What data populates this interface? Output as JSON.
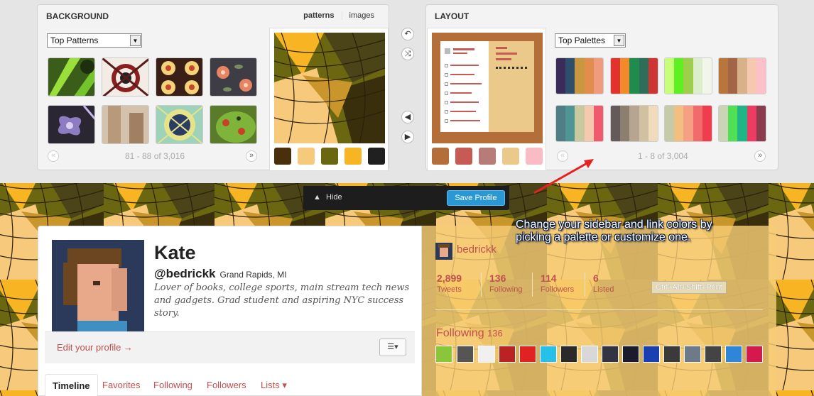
{
  "background_panel": {
    "title": "BACKGROUND",
    "tabs": [
      "patterns",
      "images"
    ],
    "active_tab": "patterns",
    "select_value": "Top Patterns",
    "pager_text": "81 - 88 of 3,016",
    "prev_icon": "«",
    "next_icon": "»",
    "pattern_swatches": [
      "#4a2f0c",
      "#f7c97a",
      "#6b6711",
      "#f7b423",
      "#202020"
    ]
  },
  "layout_panel": {
    "title": "LAYOUT",
    "select_value": "Top Palettes",
    "pager_text": "1 - 8 of 3,004",
    "prev_icon": "«",
    "next_icon": "»",
    "palette_swatches": [
      "#b36e3a",
      "#c85a54",
      "#b87c78",
      "#ebc98a",
      "#f9bcc4"
    ],
    "palettes": [
      [
        "#3b2b5b",
        "#2d4f6c",
        "#c8973f",
        "#e28d4d",
        "#f09b7e"
      ],
      [
        "#e1332e",
        "#f08a2a",
        "#1f8c4e",
        "#2e6e58",
        "#cd3535"
      ],
      [
        "#c7ff7b",
        "#5ef020",
        "#9ecf4c",
        "#ddeecc",
        "#f2f5e9"
      ],
      [
        "#b8763a",
        "#a36547",
        "#d8b089",
        "#f6c8b0",
        "#fdc0c8"
      ],
      [
        "#4f7e87",
        "#4e9693",
        "#c8c99f",
        "#f5c9ad",
        "#f05a6d"
      ],
      [
        "#645a5a",
        "#8d7f70",
        "#b7a592",
        "#d0c1a1",
        "#f0dcbc"
      ],
      [
        "#c5caa9",
        "#f2bf83",
        "#f5a082",
        "#f16a6c",
        "#ef3d4f"
      ],
      [
        "#cbd5b6",
        "#4fe055",
        "#21b585",
        "#ec3c63",
        "#8b3b4e"
      ]
    ]
  },
  "middle_controls": {
    "undo_icon": "↶",
    "shuffle_icon": "⤨",
    "left_icon": "◀",
    "right_icon": "▶"
  },
  "hide_bar": {
    "hide_label": "Hide",
    "save_label": "Save Profile"
  },
  "profile": {
    "name": "Kate",
    "handle": "@bedrickk",
    "location": "Grand Rapids, MI",
    "bio": "Lover of books, college sports, main stream tech news and gadgets. Grad student and aspiring NYC success story.",
    "edit_label": "Edit your profile →",
    "gear_label": "☰▾",
    "tabs": [
      "Timeline",
      "Favorites",
      "Following",
      "Followers",
      "Lists ▾"
    ]
  },
  "sidebar": {
    "handle": "bedrickk",
    "stats": [
      {
        "num": "2,899",
        "label": "Tweets"
      },
      {
        "num": "136",
        "label": "Following"
      },
      {
        "num": "114",
        "label": "Followers"
      },
      {
        "num": "6",
        "label": "Listed"
      }
    ],
    "following_title": "Following",
    "following_count": "136"
  },
  "tooltip": "Ctrl+Alt+Shift+Print",
  "annotation": "Change your sidebar and link colors by picking a palette or customize one."
}
